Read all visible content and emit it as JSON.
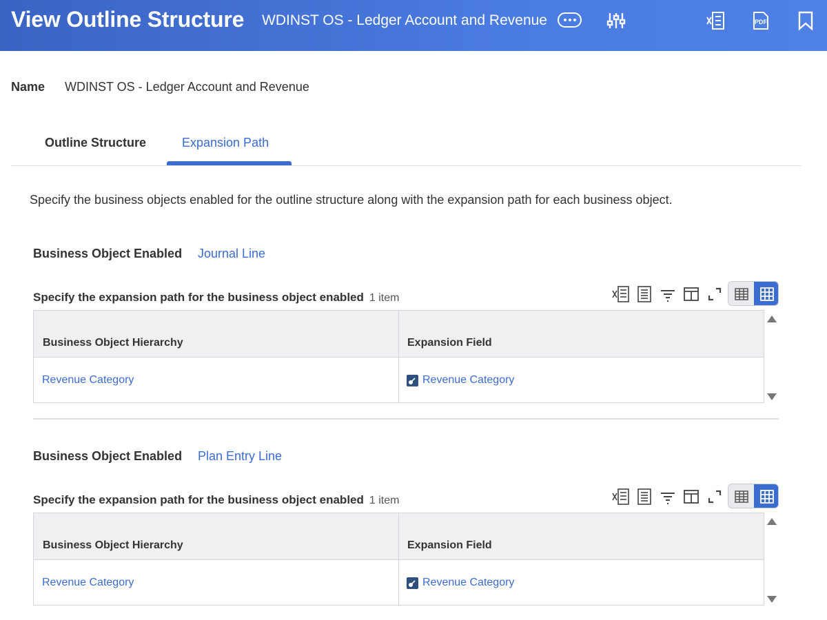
{
  "header": {
    "title": "View Outline Structure",
    "subtitle": "WDINST OS - Ledger Account and Revenue",
    "icons": [
      "more-icon",
      "related-actions-icon",
      "export-excel-icon",
      "export-pdf-icon",
      "bookmark-icon"
    ]
  },
  "name_field": {
    "label": "Name",
    "value": "WDINST OS - Ledger Account and Revenue"
  },
  "tabs": [
    {
      "label": "Outline Structure",
      "active": false
    },
    {
      "label": "Expansion Path",
      "active": true
    }
  ],
  "description": "Specify the business objects enabled for the outline structure along with the expansion path for each business object.",
  "sections": [
    {
      "bo_label": "Business Object Enabled",
      "bo_value": "Journal Line",
      "grid_title": "Specify the expansion path for the business object enabled",
      "grid_count": "1 item",
      "columns": [
        "Business Object Hierarchy",
        "Expansion Field"
      ],
      "rows": [
        [
          "Revenue Category",
          "Revenue Category"
        ]
      ]
    },
    {
      "bo_label": "Business Object Enabled",
      "bo_value": "Plan Entry Line",
      "grid_title": "Specify the expansion path for the business object enabled",
      "grid_count": "1 item",
      "columns": [
        "Business Object Hierarchy",
        "Expansion Field"
      ],
      "rows": [
        [
          "Revenue Category",
          "Revenue Category"
        ]
      ]
    }
  ],
  "colors": {
    "header_bg": "#4a7be0",
    "link": "#3b6ccf",
    "accent": "#3b6ccf",
    "object_icon": "#2f4f7f"
  }
}
